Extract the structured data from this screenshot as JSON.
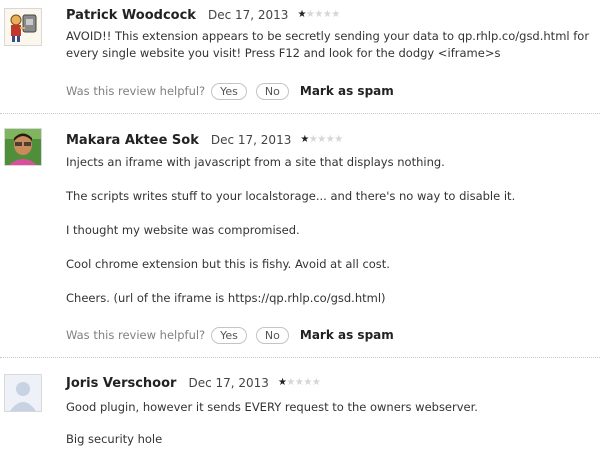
{
  "reviews": [
    {
      "author": "Patrick Woodcock",
      "date": "Dec 17, 2013",
      "rating": 1,
      "rating_max": 5,
      "avatar_icon": "cartoon-robot-avatar",
      "paragraphs": [
        "AVOID!! This extension appears to be secretly sending your data to qp.rhlp.co/gsd.html for",
        "every single website you visit! Press F12 and look for the dodgy <iframe>s"
      ],
      "helpful": {
        "question": "Was this review helpful?",
        "yes_label": "Yes",
        "no_label": "No",
        "spam_label": "Mark as spam"
      }
    },
    {
      "author": "Makara Aktee Sok",
      "date": "Dec 17, 2013",
      "rating": 1,
      "rating_max": 5,
      "avatar_icon": "person-photo-avatar",
      "paragraphs": [
        "Injects an iframe with javascript from a site that displays nothing.",
        "The scripts writes stuff to your localstorage... and there's no way to disable it.",
        "I thought my website was compromised.",
        "Cool chrome extension but this is fishy. Avoid at all cost.",
        "Cheers. (url of the iframe is https://qp.rhlp.co/gsd.html)"
      ],
      "helpful": {
        "question": "Was this review helpful?",
        "yes_label": "Yes",
        "no_label": "No",
        "spam_label": "Mark as spam"
      }
    },
    {
      "author": "Joris Verschoor",
      "date": "Dec 17, 2013",
      "rating": 1,
      "rating_max": 5,
      "avatar_icon": "default-user-silhouette-avatar",
      "paragraphs": [
        "Good plugin, however it sends EVERY request to the owners webserver.",
        "Big security hole"
      ]
    }
  ],
  "colors": {
    "text": "#333333",
    "muted": "#808080",
    "star_filled": "#222222",
    "star_empty": "#d6d6d6",
    "divider": "#c8c8c8"
  }
}
